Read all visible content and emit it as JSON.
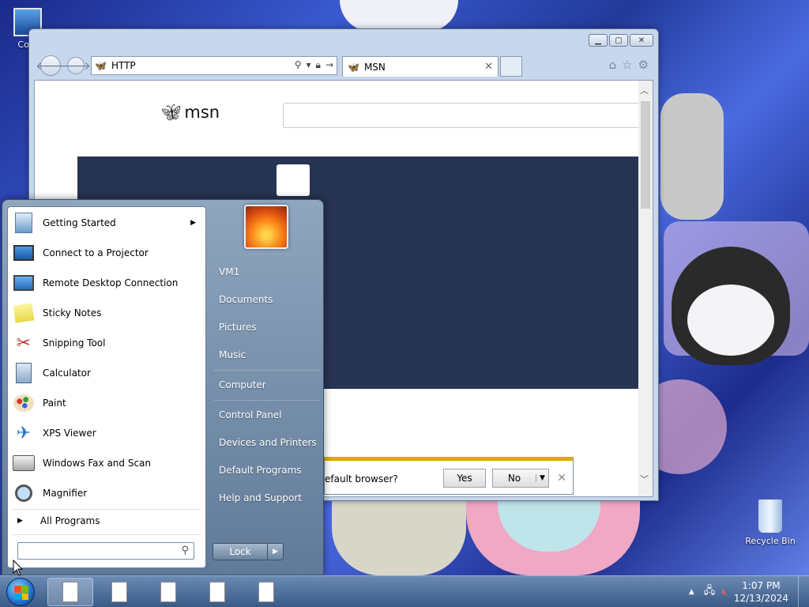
{
  "desktop": {
    "icons": [
      {
        "label": "Com"
      },
      {
        "label": "Recycle Bin"
      }
    ]
  },
  "browser": {
    "address": "HTTP",
    "tab_title": "MSN",
    "logo_text": "msn",
    "notification": {
      "text": "efault browser?",
      "yes_label": "Yes",
      "no_label": "No"
    }
  },
  "start_menu": {
    "programs": [
      {
        "label": "Getting Started",
        "icon": "getting-started-icon",
        "has_submenu": true
      },
      {
        "label": "Connect to a Projector",
        "icon": "projector-icon"
      },
      {
        "label": "Remote Desktop Connection",
        "icon": "remote-desktop-icon"
      },
      {
        "label": "Sticky Notes",
        "icon": "sticky-notes-icon"
      },
      {
        "label": "Snipping Tool",
        "icon": "snipping-tool-icon"
      },
      {
        "label": "Calculator",
        "icon": "calculator-icon"
      },
      {
        "label": "Paint",
        "icon": "paint-icon"
      },
      {
        "label": "XPS Viewer",
        "icon": "xps-viewer-icon"
      },
      {
        "label": "Windows Fax and Scan",
        "icon": "fax-scan-icon"
      },
      {
        "label": "Magnifier",
        "icon": "magnifier-icon"
      }
    ],
    "all_programs_label": "All Programs",
    "search_placeholder": "",
    "right_items": [
      {
        "label": "VM1"
      },
      {
        "label": "Documents"
      },
      {
        "label": "Pictures"
      },
      {
        "label": "Music"
      },
      {
        "label": "Computer"
      },
      {
        "label": "Control Panel"
      },
      {
        "label": "Devices and Printers"
      },
      {
        "label": "Default Programs"
      },
      {
        "label": "Help and Support"
      }
    ],
    "lock_label": "Lock"
  },
  "taskbar": {
    "time": "1:07 PM",
    "date": "12/13/2024"
  },
  "colors": {
    "hero": "#283453",
    "accent_bar": "#e0a800",
    "taskbar": "#3a5a86"
  }
}
